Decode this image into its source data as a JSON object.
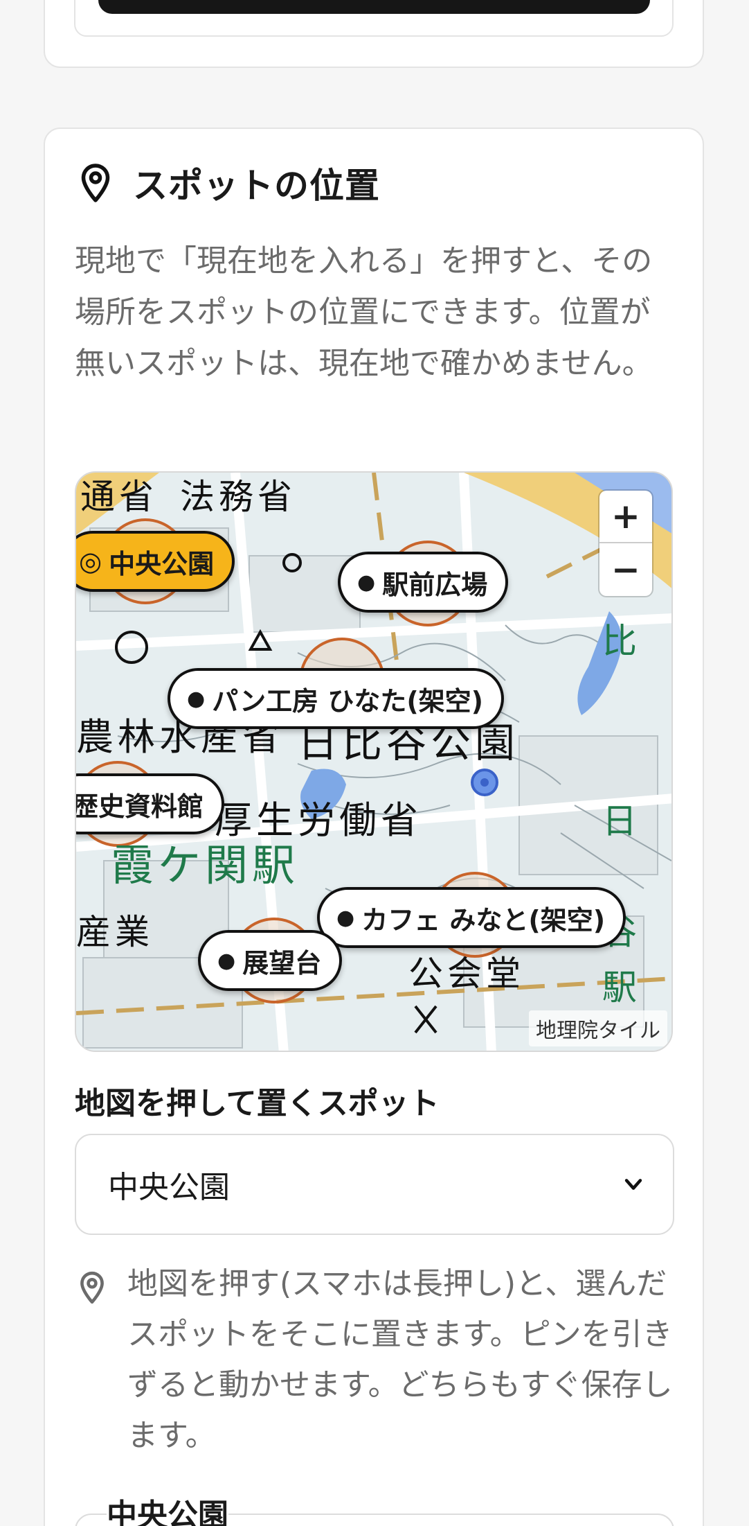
{
  "section": {
    "title": "スポットの位置",
    "title_icon": "map-pin-icon",
    "description": "現地で「現在地を入れる」を押すと、その場所をスポットの位置にできます。位置が無いスポットは、現在地で確かめません。"
  },
  "map": {
    "zoom_in": "+",
    "zoom_out": "−",
    "attribution": "地理院タイル",
    "labels": [
      "通省",
      "法務省",
      "農林水産省",
      "日比谷公園",
      "厚生労働省",
      "霞ケ関駅",
      "産業",
      "公会堂",
      "日",
      "谷",
      "駅",
      "比"
    ],
    "markers": [
      {
        "name": "中央公園",
        "selected": true
      },
      {
        "name": "駅前広場",
        "selected": false
      },
      {
        "name": "パン工房 ひなた(架空)",
        "selected": false
      },
      {
        "name": "歴史資料館",
        "selected": false
      },
      {
        "name": "カフェ みなと(架空)",
        "selected": false
      },
      {
        "name": "展望台",
        "selected": false
      }
    ]
  },
  "placement": {
    "label": "地図を押して置くスポット",
    "selected_value": "中央公園",
    "chevron_icon": "chevron-down-icon",
    "hint_icon": "map-pin-icon",
    "hint": "地図を押す(スマホは長押し)と、選んだスポットをそこに置きます。ピンを引きずると動かせます。どちらもすぐ保存します。"
  },
  "spot_detail": {
    "title": "中央公園"
  },
  "colors": {
    "accent": "#f6b41a",
    "map_water": "#7ea8e6",
    "map_park_text": "#1f7a4a"
  }
}
